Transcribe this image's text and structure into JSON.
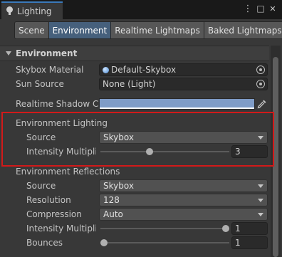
{
  "window": {
    "title": "Lighting",
    "controls": {
      "more_icon": "⋮",
      "maximize_icon": "□",
      "close_icon": "✕"
    }
  },
  "tabs": [
    {
      "label": "Scene",
      "active": false
    },
    {
      "label": "Environment",
      "active": true
    },
    {
      "label": "Realtime Lightmaps",
      "active": false
    },
    {
      "label": "Baked Lightmaps",
      "active": false
    }
  ],
  "section": {
    "title": "Environment"
  },
  "skybox_material": {
    "label": "Skybox Material",
    "value": "Default-Skybox"
  },
  "sun_source": {
    "label": "Sun Source",
    "value": "None (Light)"
  },
  "realtime_shadow_color": {
    "label": "Realtime Shadow Color",
    "color": "#7f9cc7"
  },
  "environment_lighting": {
    "heading": "Environment Lighting",
    "source": {
      "label": "Source",
      "value": "Skybox"
    },
    "intensity": {
      "label": "Intensity Multiplier",
      "value": "3",
      "fraction": 0.375
    }
  },
  "environment_reflections": {
    "heading": "Environment Reflections",
    "source": {
      "label": "Source",
      "value": "Skybox"
    },
    "resolution": {
      "label": "Resolution",
      "value": "128"
    },
    "compression": {
      "label": "Compression",
      "value": "Auto"
    },
    "intensity": {
      "label": "Intensity Multiplier",
      "value": "1",
      "fraction": 1.0
    },
    "bounces": {
      "label": "Bounces",
      "value": "1",
      "fraction": 0.0
    }
  },
  "colors": {
    "accent": "#3a79bb",
    "highlight": "#d21a1a",
    "active_tab": "#46607c"
  }
}
